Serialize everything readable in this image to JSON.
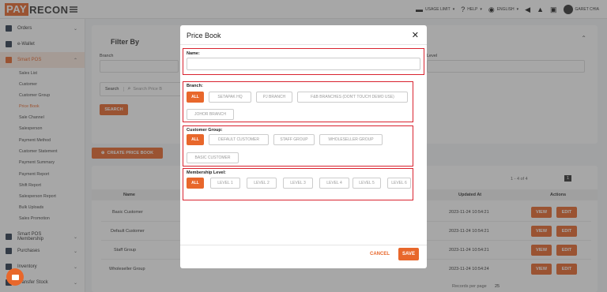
{
  "brand": {
    "pay": "PAY",
    "recon": "RECON"
  },
  "topbar": {
    "usage": "USAGE LIMIT",
    "help": "HELP",
    "language": "ENGLISH",
    "user": "GARET CHIA"
  },
  "sidebar": {
    "orders": "Orders",
    "ewallet": "e-Wallet",
    "smartpos": "Smart POS",
    "subitems": [
      "Sales List",
      "Customer",
      "Customer Group",
      "Price Book",
      "Sale Channel",
      "Salesperson",
      "Payment Method",
      "Customer Statement",
      "Payment Summary",
      "Payment Report",
      "Shift Report",
      "Salesperson Report",
      "Bulk Uploads",
      "Sales Promotion"
    ],
    "selected_sub": "Price Book",
    "smartpos_membership": "Smart POS Membership",
    "purchases": "Purchases",
    "inventory": "Inventory",
    "transfer": "Transfer Stock"
  },
  "filter": {
    "title": "Filter By",
    "branch_label": "Branch",
    "level_label": "Level",
    "search_label": "Search",
    "search_placeholder": "Search Price B",
    "search_button": "SEARCH"
  },
  "create_button": "CREATE PRICE BOOK",
  "table": {
    "headers": {
      "name": "Name",
      "updated": "Updated At",
      "actions": "Actions"
    },
    "rows": [
      {
        "name": "Basic Customer",
        "updated": "2023-11-24 10:54:21"
      },
      {
        "name": "Default Customer",
        "updated": "2023-11-24 10:54:21"
      },
      {
        "name": "Staff Group",
        "updated": "2023-11-24 10:54:21"
      },
      {
        "name": "Wholeseller Group",
        "updated": "2023-11-24 10:54:24"
      }
    ],
    "view": "VIEW",
    "edit": "EDIT",
    "pagination": "1 - 4 of 4",
    "page": "1",
    "records_label": "Records per page",
    "records_value": "25"
  },
  "modal": {
    "title": "Price Book",
    "name_label": "Name:",
    "branch_label": "Branch:",
    "branches": [
      "ALL",
      "SETAPAK HQ",
      "PJ BRANCH",
      "F&B BRANCHES (DON'T TOUCH DEMO USE)",
      "JOHOR BRANCH"
    ],
    "group_label": "Customer Group:",
    "groups": [
      "ALL",
      "DEFAULT CUSTOMER",
      "STAFF GROUP",
      "WHOLESELLER GROUP",
      "BASIC CUSTOMER"
    ],
    "level_label": "Membership Level:",
    "levels": [
      "ALL",
      "LEVEL 1",
      "LEVEL 2",
      "LEVEL 3",
      "LEVEL 4",
      "LEVEL 5",
      "LEVEL 6"
    ],
    "cancel": "CANCEL",
    "save": "SAVE"
  },
  "colors": {
    "accent": "#e8672b",
    "highlight": "#d9232f"
  }
}
